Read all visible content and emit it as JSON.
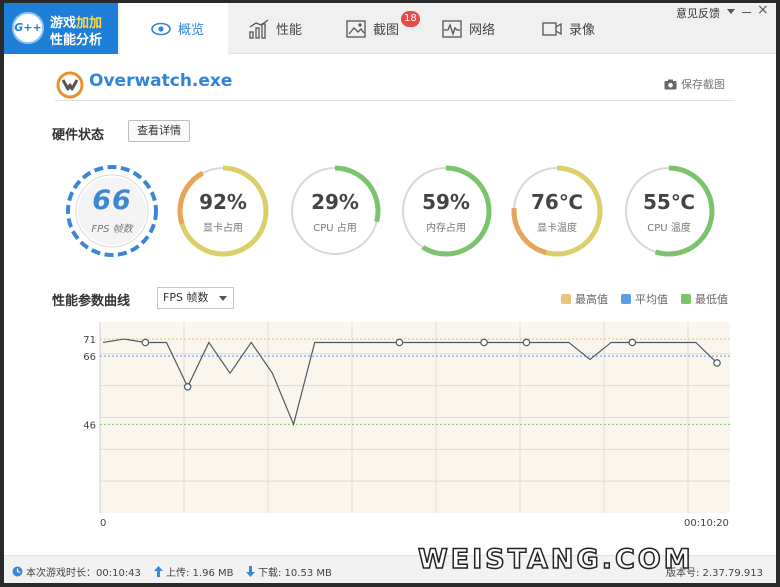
{
  "app": {
    "logo_line1_a": "游戏",
    "logo_line1_b": "加加",
    "logo_line2": "性能分析",
    "logo_mark": "G++"
  },
  "tabs": [
    {
      "label": "概览",
      "icon": "eye-icon",
      "active": true
    },
    {
      "label": "性能",
      "icon": "bar-chart-icon",
      "active": false
    },
    {
      "label": "截图",
      "icon": "image-icon",
      "active": false,
      "badge": "18"
    },
    {
      "label": "网络",
      "icon": "pulse-icon",
      "active": false
    },
    {
      "label": "录像",
      "icon": "video-icon",
      "active": false
    }
  ],
  "window": {
    "feedback_label": "意见反馈",
    "minimize_icon": "minimize-icon",
    "close_icon": "close-icon",
    "close_glyph": "×"
  },
  "header": {
    "game_title": "Overwatch.exe",
    "save_screenshot_label": "保存截图"
  },
  "hardware": {
    "section_title": "硬件状态",
    "details_button": "查看详情",
    "fps": {
      "value": "66",
      "label": "FPS 帧数"
    },
    "gauges": [
      {
        "value": "92%",
        "label": "显卡占用",
        "fraction": 0.92
      },
      {
        "value": "29%",
        "label": "CPU 占用",
        "fraction": 0.29
      },
      {
        "value": "59%",
        "label": "内存占用",
        "fraction": 0.59
      },
      {
        "value": "76℃",
        "label": "显卡温度",
        "fraction": 0.76
      },
      {
        "value": "55℃",
        "label": "CPU 温度",
        "fraction": 0.55
      }
    ],
    "colors": {
      "track": "#d8d8d8",
      "green": "#7cc36d",
      "yellow": "#dccf69",
      "orange": "#e8a45a",
      "blue": "#3d86d6"
    }
  },
  "curve": {
    "section_title": "性能参数曲线",
    "select_value": "FPS 帧数",
    "legend": [
      {
        "label": "最高值",
        "color": "#e8c57a"
      },
      {
        "label": "平均值",
        "color": "#5b9de3"
      },
      {
        "label": "最低值",
        "color": "#7cc36d"
      }
    ],
    "x_start_label": "0",
    "x_end_label": "00:10:20"
  },
  "chart_data": {
    "type": "line",
    "series": [
      {
        "values": [
          70,
          71,
          70,
          70,
          57,
          70,
          61,
          70,
          61,
          46,
          70,
          70,
          70,
          70,
          70,
          70,
          70,
          70,
          70,
          70,
          70,
          70,
          70,
          65,
          70,
          70,
          70,
          70,
          70,
          64
        ]
      }
    ],
    "marker_indices": [
      2,
      4,
      14,
      18,
      20,
      25,
      29
    ],
    "reference_lines": [
      {
        "label": "71",
        "value": 71,
        "color": "#e8c57a"
      },
      {
        "label": "66",
        "value": 66,
        "color": "#5b9de3"
      },
      {
        "label": "46",
        "value": 46,
        "color": "#7cc36d"
      }
    ],
    "y_range": [
      20,
      76
    ],
    "x_range_label": [
      "0",
      "00:10:20"
    ],
    "grid": true
  },
  "status": {
    "session_label": "本次游戏时长：00:10:43",
    "upload_label": "上传: 1.96 MB",
    "download_label": "下载: 10.53 MB",
    "version_label": "版本号: 2.37.79.913"
  },
  "watermark": "WEISTANG.COM"
}
